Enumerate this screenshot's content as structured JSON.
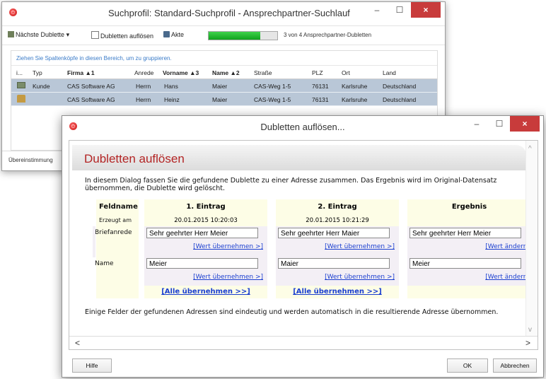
{
  "main_window": {
    "title": "Suchprofil: Standard-Suchprofil - Ansprechpartner-Suchlauf",
    "controls": {
      "minimize": "–",
      "maximize": "☐",
      "close": "×"
    },
    "toolbar": {
      "next_duplicate": "Nächste Dublette",
      "resolve_duplicates": "Dubletten auflösen",
      "file": "Akte",
      "progress_fraction": 0.75,
      "progress_text": "3 von 4 Ansprechpartner-Dubletten"
    },
    "group_hint": "Ziehen Sie Spaltenköpfe in diesen Bereich, um zu gruppieren.",
    "columns": [
      "i...",
      "Typ",
      "Firma ▲1",
      "Anrede",
      "Vorname ▲3",
      "Name ▲2",
      "Straße",
      "PLZ",
      "Ort",
      "Land"
    ],
    "rows": [
      {
        "typ": "Kunde",
        "firma": "CAS Software AG",
        "anrede": "Herrn",
        "vorname": "Hans",
        "name": "Maier",
        "strasse": "CAS-Weg 1-5",
        "plz": "76131",
        "ort": "Karlsruhe",
        "land": "Deutschland"
      },
      {
        "typ": "",
        "firma": "CAS Software AG",
        "anrede": "Herrn",
        "vorname": "Heinz",
        "name": "Maier",
        "strasse": "CAS-Weg 1-5",
        "plz": "76131",
        "ort": "Karlsruhe",
        "land": "Deutschland"
      }
    ],
    "status_text": "Übereinstimmung"
  },
  "dialog": {
    "title": "Dubletten auflösen...",
    "controls": {
      "minimize": "–",
      "maximize": "☐",
      "close": "×"
    },
    "heading": "Dubletten auflösen",
    "intro": "In diesem Dialog fassen Sie die gefundene Dublette zu einer Adresse zusammen. Das Ergebnis wird im Original-Datensatz übernommen, die Dublette wird gelöscht.",
    "table": {
      "field_header": "Feldname",
      "entry1_header": "1. Eintrag",
      "entry2_header": "2. Eintrag",
      "result_header": "Ergebnis",
      "created_label": "Erzeugt am",
      "entry1_date": "20.01.2015 10:20:03",
      "entry2_date": "20.01.2015 10:21:29",
      "salutation_label": "Briefanrede",
      "entry1_salutation": "Sehr geehrter Herr Meier",
      "entry2_salutation": "Sehr geehrter Herr Maier",
      "result_salutation": "Sehr geehrter Herr Meier",
      "name_label": "Name",
      "entry1_name": "Meier",
      "entry2_name": "Maier",
      "result_name": "Meier",
      "take_value": "[Wert übernehmen >]",
      "change_value": "[Wert ändern]",
      "take_all": "[Alle übernehmen >>]"
    },
    "auto_note": "Einige Felder der gefundenen Adressen sind eindeutig und werden automatisch in die resultierende Adresse übernommen.",
    "scroll_left": "<",
    "scroll_right": ">",
    "scroll_up": "^",
    "scroll_down": "v",
    "buttons": {
      "help": "Hilfe",
      "ok": "OK",
      "cancel": "Abbrechen"
    }
  }
}
